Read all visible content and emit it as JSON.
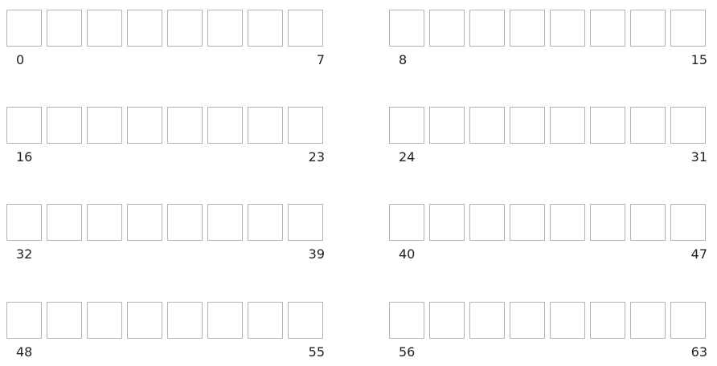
{
  "diagram": {
    "cells_per_group": 8,
    "groups": [
      {
        "start_label": "0",
        "end_label": "7"
      },
      {
        "start_label": "8",
        "end_label": "15"
      },
      {
        "start_label": "16",
        "end_label": "23"
      },
      {
        "start_label": "24",
        "end_label": "31"
      },
      {
        "start_label": "32",
        "end_label": "39"
      },
      {
        "start_label": "40",
        "end_label": "47"
      },
      {
        "start_label": "48",
        "end_label": "55"
      },
      {
        "start_label": "56",
        "end_label": "63"
      }
    ]
  }
}
